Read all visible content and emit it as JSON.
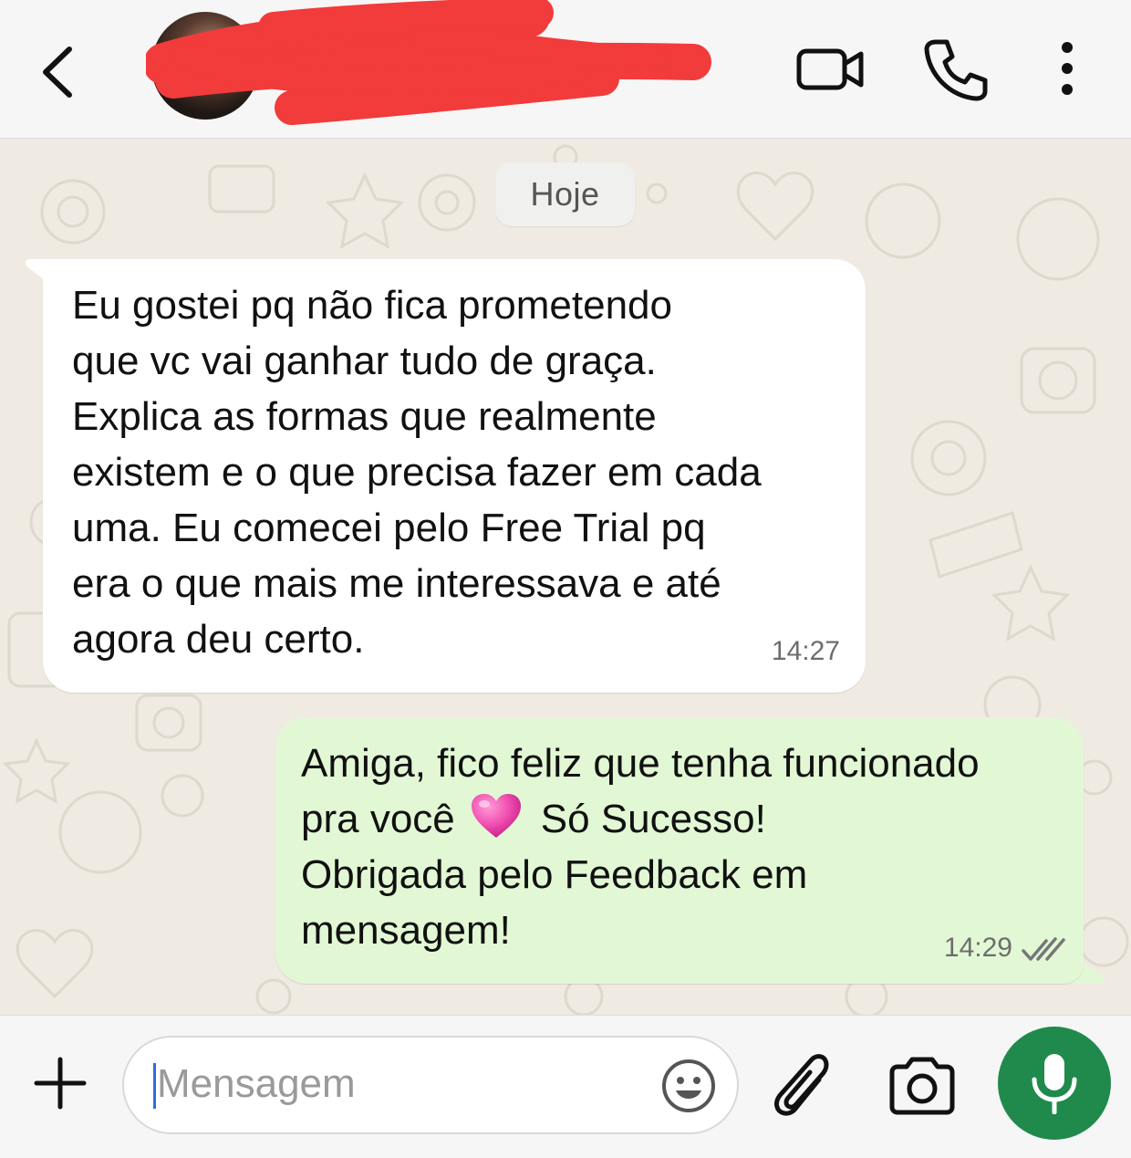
{
  "header": {
    "contact_name_redacted": true,
    "icons": [
      "back-chevron-icon",
      "avatar",
      "video-camera-icon",
      "phone-icon",
      "more-vertical-icon"
    ]
  },
  "chat": {
    "date_separator": "Hoje",
    "messages": [
      {
        "direction": "incoming",
        "text": "Eu gostei pq não fica prometendo\nque vc vai ganhar tudo de graça.\nExplica as formas que realmente\nexistem e o que precisa fazer em cada\numa. Eu comecei pelo Free Trial pq\nera o que mais me interessava e até\nagora deu certo.",
        "time": "14:27"
      },
      {
        "direction": "outgoing",
        "text_line1": "Amiga, fico feliz que tenha funcionado",
        "text_line2_before_emoji": "pra você",
        "emoji": "pink-heart",
        "text_line2_after_emoji": "Só Sucesso!",
        "text_rest": "Obrigada pelo Feedback em\nmensagem!",
        "time": "14:29",
        "status": "read-double-check"
      }
    ]
  },
  "input_bar": {
    "placeholder": "Mensagem",
    "icons": [
      "plus-icon",
      "emoji-icon",
      "paperclip-icon",
      "camera-icon",
      "microphone-icon"
    ],
    "mic_color": "#1f8a4c"
  },
  "colors": {
    "header_bg": "#f6f6f6",
    "chat_bg": "#efeae2",
    "incoming_bubble": "#ffffff",
    "outgoing_bubble": "#e2f8d5",
    "redaction": "#f23b3b",
    "read_ticks": "#777777"
  }
}
